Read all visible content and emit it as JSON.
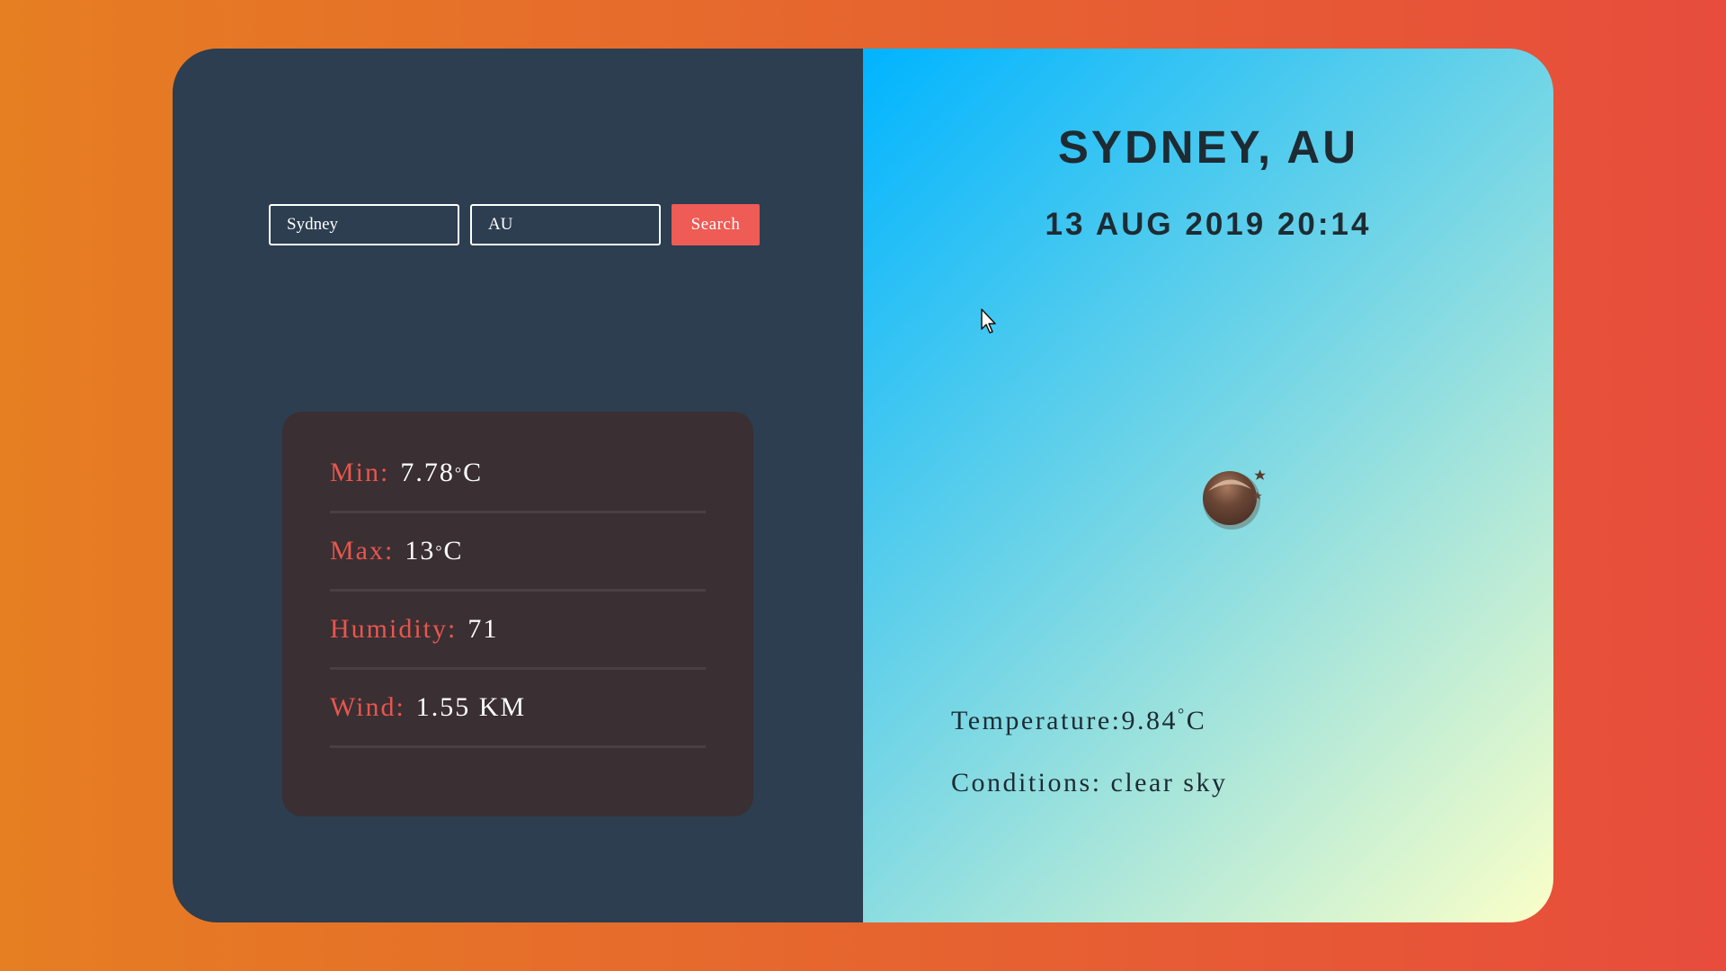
{
  "search": {
    "city_value": "Sydney",
    "country_value": "AU",
    "button_label": "Search"
  },
  "details": {
    "min_label": "Min:",
    "min_value": "7.78",
    "max_label": "Max:",
    "max_value": "13",
    "humidity_label": "Humidity:",
    "humidity_value": "71",
    "wind_label": "Wind:",
    "wind_value": "1.55 KM",
    "degree_symbol": "°",
    "unit": "C"
  },
  "location": {
    "city": "SYDNEY, AU",
    "datetime": "13 AUG 2019 20:14"
  },
  "current": {
    "temperature_label": "Temperature:",
    "temperature_value": "9.84",
    "conditions_label": "Conditions:",
    "conditions_value": "clear sky",
    "icon": "clear-night-moon-icon"
  },
  "colors": {
    "page_gradient": [
      "#e67e22",
      "#e74c3c"
    ],
    "left_panel": "#2c3e50",
    "details_card": "#3a2f33",
    "label_accent": "#e8564d",
    "search_button": "#ef5b55",
    "right_gradient": [
      "#00b4ff",
      "#7cd8e4",
      "#fbffc8"
    ]
  }
}
